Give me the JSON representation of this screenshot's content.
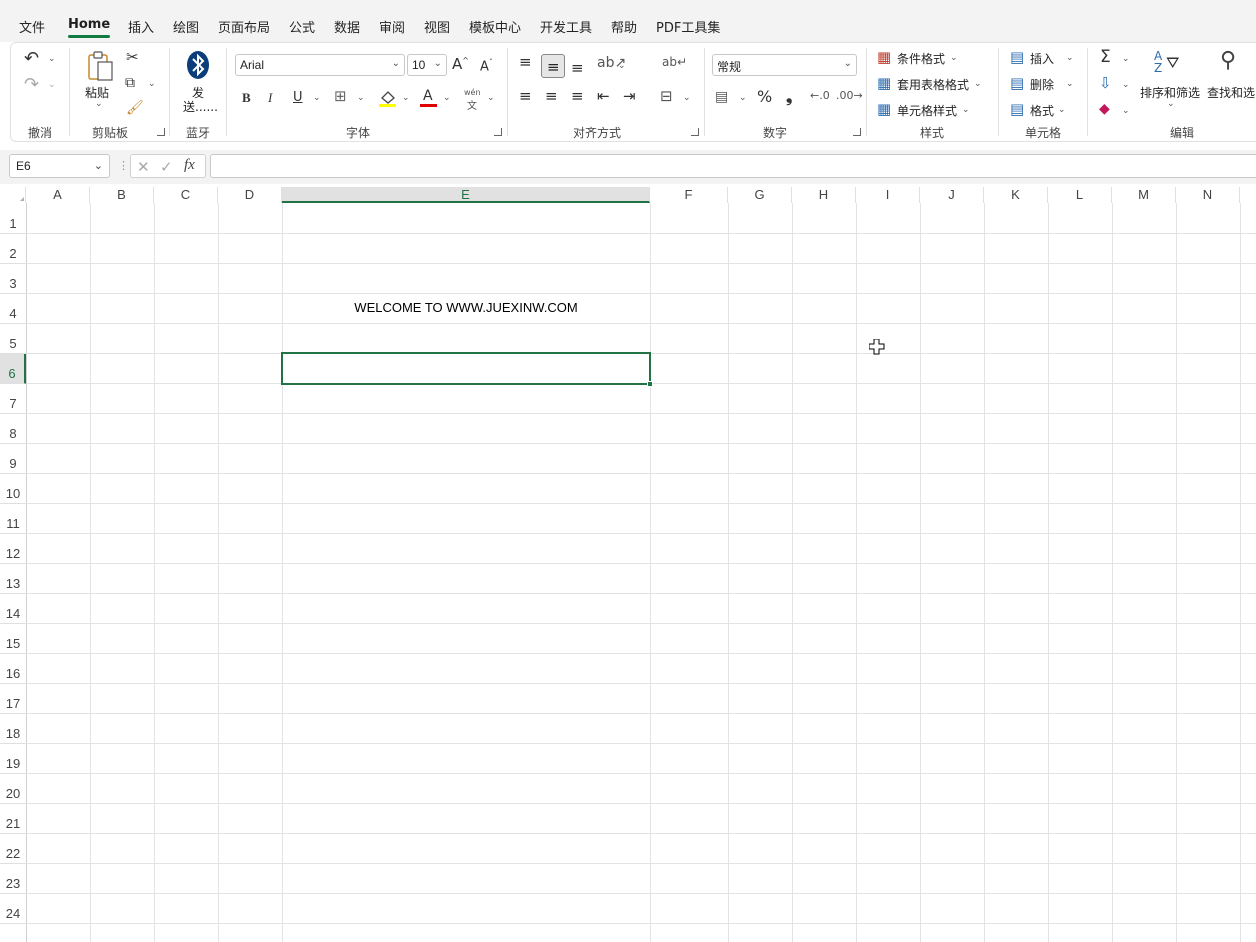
{
  "menu": {
    "items": [
      "文件",
      "Home",
      "插入",
      "绘图",
      "页面布局",
      "公式",
      "数据",
      "审阅",
      "视图",
      "模板中心",
      "开发工具",
      "帮助",
      "PDF工具集"
    ],
    "active": "Home"
  },
  "ribbon": {
    "groups": {
      "undo": "撤消",
      "clipboard": "剪贴板",
      "bluetooth": "蓝牙",
      "font": "字体",
      "alignment": "对齐方式",
      "number": "数字",
      "styles": "样式",
      "cells": "单元格",
      "editing": "编辑"
    },
    "paste_label": "粘贴",
    "send_label_1": "发",
    "send_label_2": "送......",
    "font_name": "Arial",
    "font_size": "10",
    "number_format": "常规",
    "conditional_format": "条件格式",
    "table_format": "套用表格格式",
    "cell_styles": "单元格样式",
    "insert": "插入",
    "delete": "删除",
    "format": "格式",
    "sort_filter": "排序和筛选",
    "find_select": "查找和选",
    "bold": "B",
    "italic": "I",
    "underline": "U",
    "percent": "%",
    "comma": "❟",
    "wen_top": "wén",
    "wen_bottom": "文"
  },
  "formula_bar": {
    "name_box": "E6",
    "fx": "fx",
    "formula": ""
  },
  "sheet": {
    "columns": [
      "A",
      "B",
      "C",
      "D",
      "E",
      "F",
      "G",
      "H",
      "I",
      "J",
      "K",
      "L",
      "M",
      "N"
    ],
    "rows": [
      "1",
      "2",
      "3",
      "4",
      "5",
      "6",
      "7",
      "8",
      "9",
      "10",
      "11",
      "12",
      "13",
      "14",
      "15",
      "16",
      "17",
      "18",
      "19",
      "20",
      "21",
      "22",
      "23",
      "24"
    ],
    "selected_cell": "E6",
    "cells": {
      "E4": "WELCOME TO WWW.JUEXINW.COM"
    }
  },
  "colors": {
    "accent": "#217346",
    "tab_underline": "#107c41"
  }
}
